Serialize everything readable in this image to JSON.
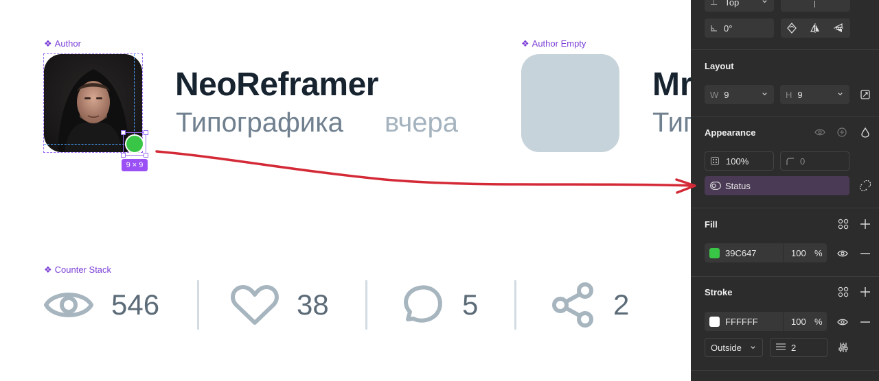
{
  "canvas": {
    "author_label": "Author",
    "author_empty_label": "Author Empty",
    "counter_stack_label": "Counter Stack",
    "size_badge": "9 × 9",
    "author": {
      "name": "NeoReframer",
      "subtitle": "Типографика",
      "time": "вчера"
    },
    "author_empty": {
      "name": "Mr",
      "subtitle": "Тип"
    },
    "counters": [
      {
        "icon": "eye-icon",
        "value": "546"
      },
      {
        "icon": "heart-icon",
        "value": "38"
      },
      {
        "icon": "comment-icon",
        "value": "5"
      },
      {
        "icon": "share-icon",
        "value": "2"
      }
    ],
    "colors": {
      "status_green": "#39C647",
      "label_purple": "#7B3FD6",
      "arrow_red": "#D42A37"
    }
  },
  "panel": {
    "constraints": {
      "vertical_value": "Top",
      "rotation": "0°"
    },
    "layout": {
      "title": "Layout",
      "w_label": "W",
      "w_value": "9",
      "h_label": "H",
      "h_value": "9"
    },
    "appearance": {
      "title": "Appearance",
      "opacity": "100%",
      "radius": "0",
      "variable": "Status"
    },
    "fill": {
      "title": "Fill",
      "hex": "39C647",
      "opacity": "100",
      "unit": "%",
      "swatch": "#39C647"
    },
    "stroke": {
      "title": "Stroke",
      "hex": "FFFFFF",
      "opacity": "100",
      "unit": "%",
      "swatch": "#FFFFFF",
      "position": "Outside",
      "weight": "2"
    }
  }
}
